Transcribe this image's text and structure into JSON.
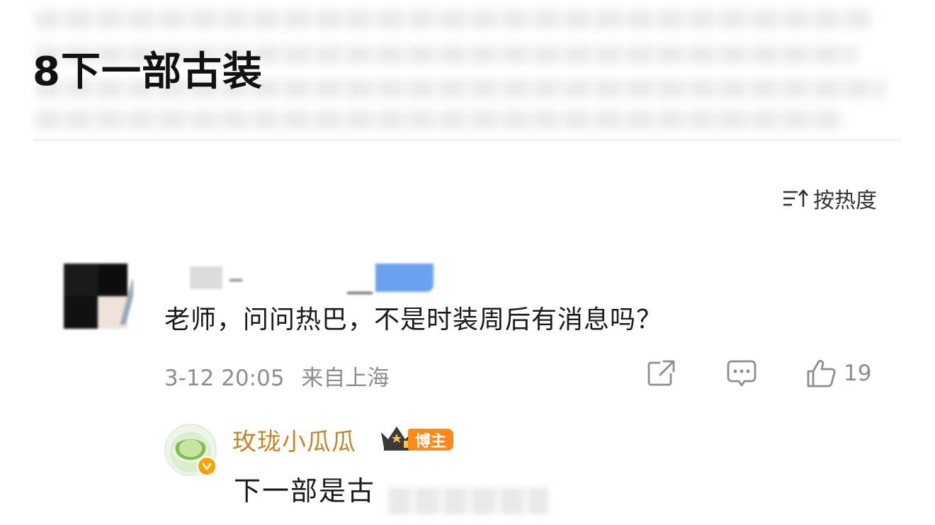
{
  "post": {
    "title": "8下一部古装"
  },
  "comments_header": {
    "sort_label": "按热度",
    "sort_icon": "sort-descending-icon"
  },
  "comment": {
    "text": "老师，问问热巴，不是时装周后有消息吗？",
    "date": "3-12 20:05",
    "location": "来自上海",
    "like_count": "19",
    "icons": [
      "share-icon",
      "reply-icon",
      "like-icon"
    ]
  },
  "reply": {
    "author": "玫珑小瓜瓜",
    "author_badge": "博主",
    "author_color": "#c4882b",
    "badge_color": "#ff8a1a",
    "text": "下一部是古"
  }
}
